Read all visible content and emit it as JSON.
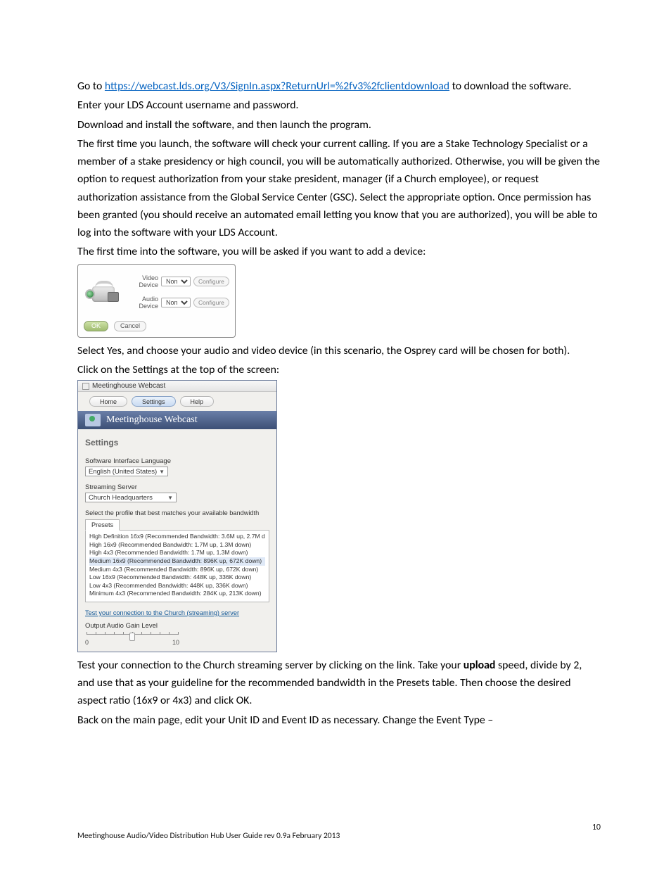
{
  "body": {
    "p1_pre": "Go to ",
    "p1_link": "https://webcast.lds.org/V3/SignIn.aspx?ReturnUrl=%2fv3%2fclientdownload",
    "p1_post": " to download the software.",
    "p2": "Enter your LDS Account username and password.",
    "p3": "Download and install the software, and then launch the program.",
    "p4": "The first time you launch, the software will check your current calling. If you are a Stake Technology Specialist or a member of a stake presidency or high council, you will be automatically authorized. Otherwise, you will be given the option to request authorization from your stake president, manager (if a Church employee), or request authorization assistance from the Global Service Center (GSC). Select the appropriate option. Once permission has been granted (you should receive an automated email letting you know that you are authorized), you will be able to log into the software with your LDS Account.",
    "p5": "The first time into the software, you will be asked if you want to add a device:",
    "p6": "Select Yes, and choose your audio and video device (in this scenario, the Osprey card will be chosen for both).",
    "p7": "Click on the Settings at the top of the screen:",
    "p8_pre": "Test your connection to the Church streaming server by clicking on the link. Take your ",
    "p8_bold": "upload",
    "p8_post": " speed, divide by 2, and use that as your guideline for the recommended bandwidth in the Presets table. Then choose the desired aspect ratio (16x9 or 4x3) and click OK.",
    "p9": "Back on the main page, edit your Unit ID and Event ID as necessary. Change the Event Type –"
  },
  "dialog1": {
    "video_label": "Video Device",
    "audio_label": "Audio Device",
    "none_opt": "None",
    "configure": "Configure",
    "ok": "OK",
    "cancel": "Cancel"
  },
  "dialog2": {
    "window_title": "Meetinghouse Webcast",
    "tabs": {
      "home": "Home",
      "settings": "Settings",
      "help": "Help"
    },
    "banner": "Meetinghouse Webcast",
    "section_title": "Settings",
    "lang_label": "Software Interface Language",
    "lang_value": "English (United States)",
    "server_label": "Streaming Server",
    "server_value": "Church Headquarters",
    "profile_desc": "Select the profile that best matches your available bandwidth",
    "presets_tab": "Presets",
    "presets": [
      "High Definition 16x9 (Recommended Bandwidth: 3.6M up, 2.7M down)",
      "High 16x9 (Recommended Bandwidth: 1.7M up, 1.3M down)",
      "High 4x3 (Recommended Bandwidth: 1.7M up, 1.3M down)",
      "Medium 16x9 (Recommended Bandwidth: 896K up, 672K down)",
      "Medium 4x3 (Recommended Bandwidth: 896K up, 672K down)",
      "Low 16x9 (Recommended Bandwidth: 448K up, 336K down)",
      "Low 4x3 (Recommended Bandwidth: 448K up, 336K down)",
      "Minimum 4x3 (Recommended Bandwidth: 284K up, 213K down)"
    ],
    "test_link": "Test your connection to the Church (streaming) server",
    "gain_label": "Output Audio Gain Level",
    "gain_min": "0",
    "gain_max": "10"
  },
  "footer": {
    "left": "Meetinghouse Audio/Video Distribution Hub User Guide rev 0.9a February 2013",
    "page": "10"
  }
}
